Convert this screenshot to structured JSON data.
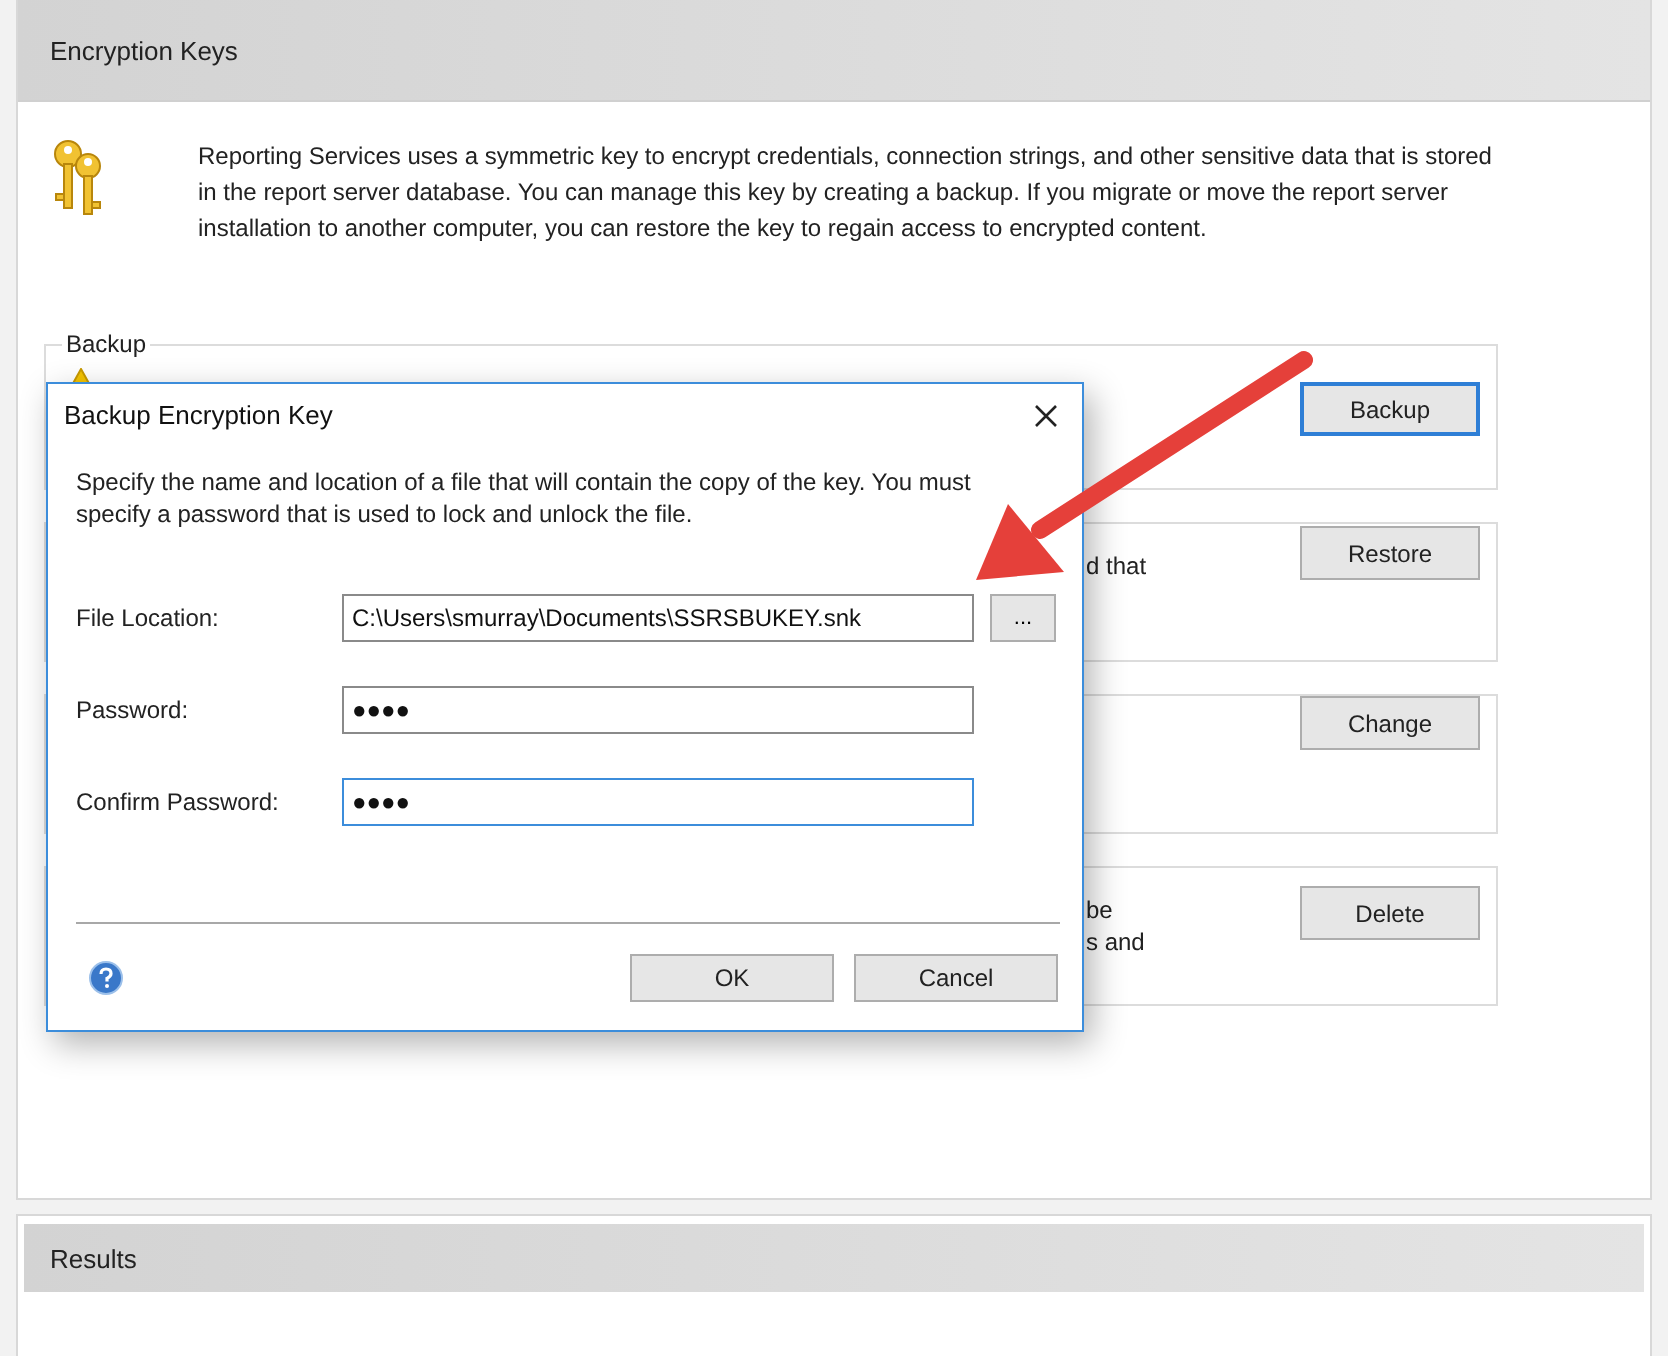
{
  "panel": {
    "title": "Encryption Keys",
    "intro": [
      "Reporting Services uses a symmetric key to encrypt credentials, connection strings, and other sensitive data that is stored",
      "in the report server database.  You can manage this key by creating a backup.  If you migrate or move the report server",
      "installation to another computer, you can restore the key to regain access to encrypted content."
    ]
  },
  "sections": [
    {
      "kind": "warning",
      "title": "Backup",
      "button": {
        "label": "Backup",
        "focused": true
      }
    },
    {
      "kind": "plain",
      "description": [
        "d that"
      ],
      "button": {
        "label": "Restore",
        "focused": false
      }
    },
    {
      "kind": "plain",
      "button": {
        "label": "Change",
        "focused": false
      }
    },
    {
      "kind": "plain",
      "description": [
        "be",
        "s and"
      ],
      "button": {
        "label": "Delete",
        "focused": false
      }
    }
  ],
  "dialog": {
    "title": "Backup Encryption Key",
    "instructions": "Specify the name and location of a file that will contain the copy of the key.  You must specify a password that is used to lock and unlock the file.",
    "fields": [
      {
        "label": "File Location:",
        "value": "C:\\Users\\smurray\\Documents\\SSRSBUKEY.snk",
        "focused": false,
        "browse": "..."
      },
      {
        "label": "Password:",
        "value": "●●●●",
        "focused": false
      },
      {
        "label": "Confirm Password:",
        "value": "●●●●",
        "focused": true
      }
    ],
    "buttons": [
      "OK",
      "Cancel"
    ]
  },
  "results": {
    "title": "Results"
  }
}
